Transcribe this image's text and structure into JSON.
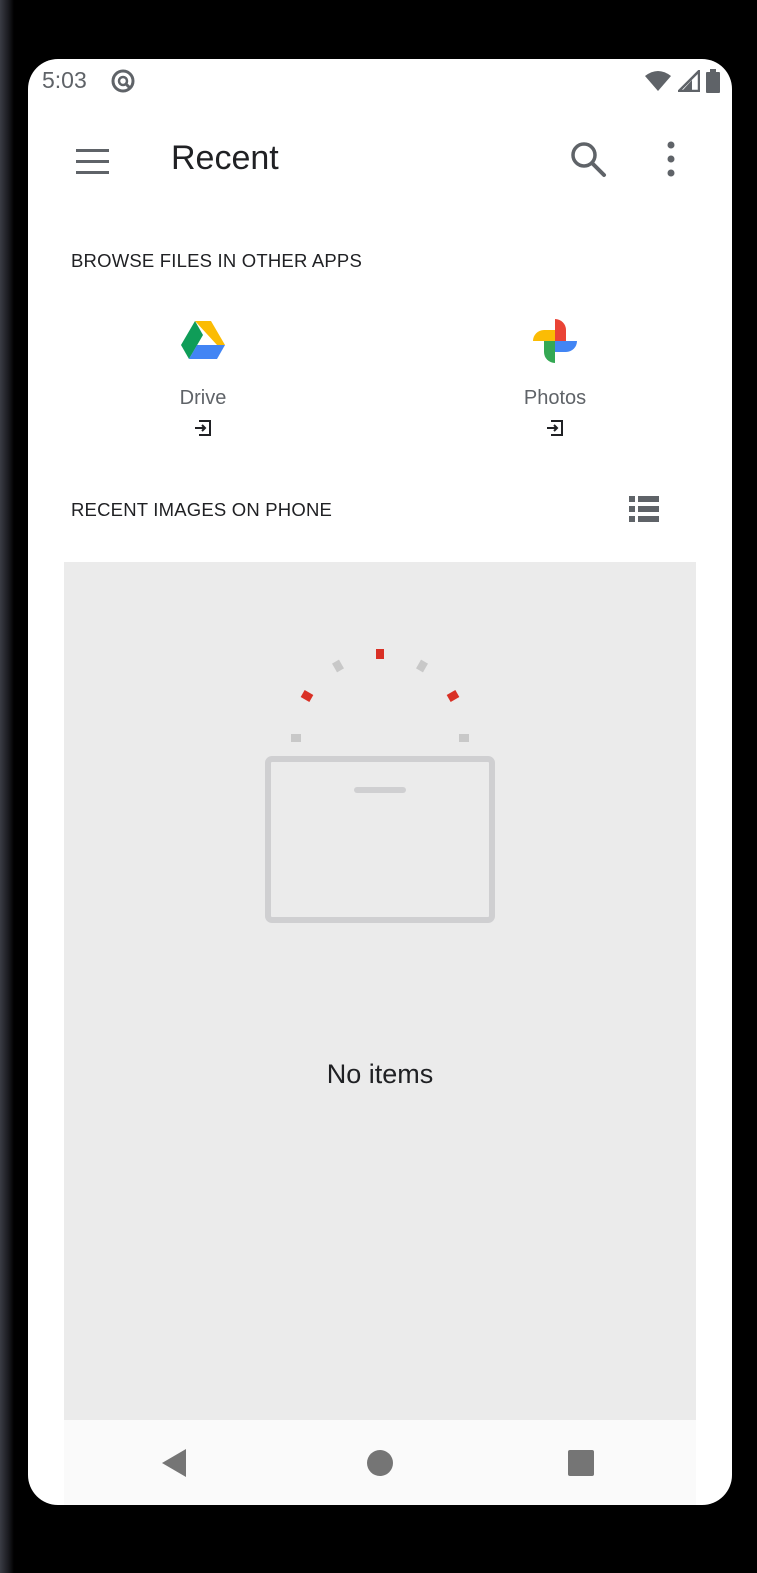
{
  "status_bar": {
    "time": "5:03",
    "icons": [
      "app-notification-icon",
      "wifi-icon",
      "cell-signal-icon",
      "battery-icon"
    ]
  },
  "app_bar": {
    "title": "Recent",
    "icons": [
      "menu-icon",
      "search-icon",
      "more-vert-icon"
    ]
  },
  "browse": {
    "header": "BROWSE FILES IN OTHER APPS",
    "apps": [
      {
        "label": "Drive",
        "icon": "google-drive-icon",
        "secondary_icon": "open-in-app-icon"
      },
      {
        "label": "Photos",
        "icon": "google-photos-icon",
        "secondary_icon": "open-in-app-icon"
      }
    ]
  },
  "recent": {
    "header": "RECENT IMAGES ON PHONE",
    "view_toggle_icon": "list-view-icon",
    "empty_text": "No items"
  },
  "nav_bar": {
    "icons": [
      "back-icon",
      "home-icon",
      "recents-icon"
    ]
  },
  "colors": {
    "accent_red": "#d93025",
    "panel_bg": "#ebebeb",
    "text_primary": "#202124",
    "text_secondary": "#5f6368"
  }
}
